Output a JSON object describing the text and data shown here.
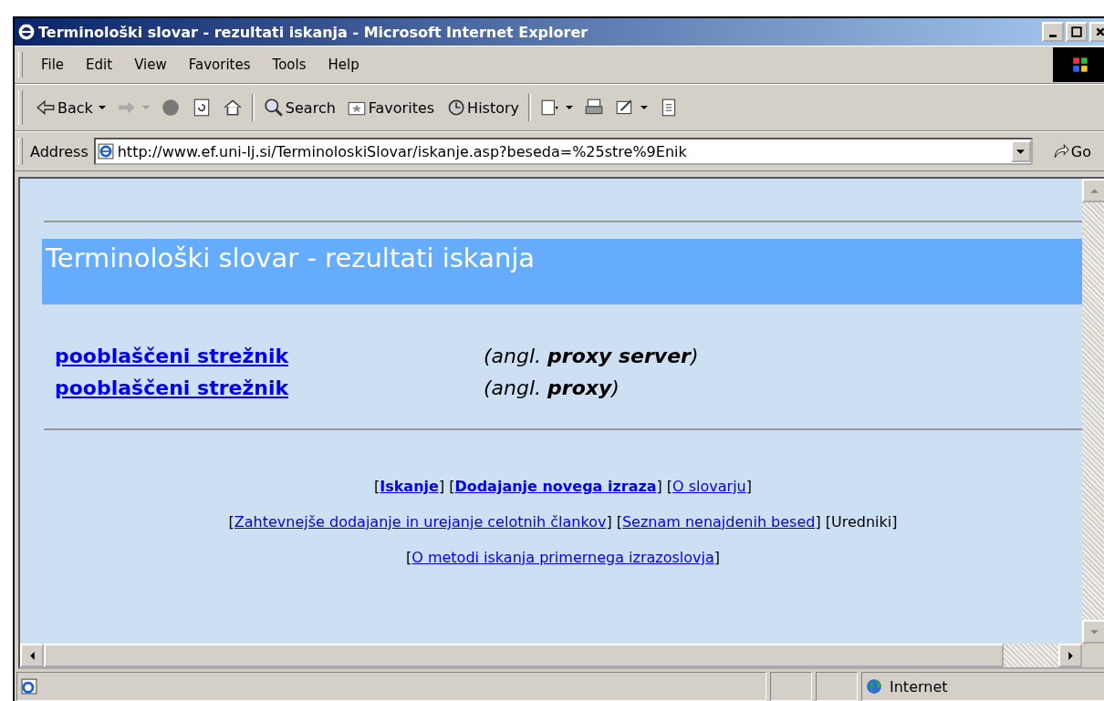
{
  "window": {
    "title": "Terminološki slovar - rezultati iskanja - Microsoft Internet Explorer"
  },
  "menu": [
    "File",
    "Edit",
    "View",
    "Favorites",
    "Tools",
    "Help"
  ],
  "toolbar": [
    {
      "kind": "back",
      "label": "Back"
    },
    {
      "kind": "forward"
    },
    {
      "kind": "stop"
    },
    {
      "kind": "refresh"
    },
    {
      "kind": "home"
    },
    {
      "kind": "search",
      "label": "Search"
    },
    {
      "kind": "favorites",
      "label": "Favorites"
    },
    {
      "kind": "history",
      "label": "History"
    },
    {
      "kind": "mail"
    },
    {
      "kind": "print"
    },
    {
      "kind": "edit"
    },
    {
      "kind": "discuss"
    }
  ],
  "address": {
    "label": "Address",
    "value": "http://www.ef.uni-lj.si/TerminoloskiSlovar/iskanje.asp?beseda=%25stre%9Enik",
    "go": "Go"
  },
  "page": {
    "heading": "Terminološki slovar - rezultati iskanja",
    "results": [
      {
        "term": "pooblaščeni strežnik",
        "translation": "(*angl.* **proxy server**)"
      },
      {
        "term": "pooblaščeni strežnik",
        "translation": "(*angl.* **proxy**)"
      }
    ],
    "footer": [
      [
        {
          "open": "[",
          "text": "Iskanje",
          "close": "]",
          "kind": "bold-link"
        },
        {
          "open": "[",
          "text": "Dodajanje novega izraza",
          "close": "]",
          "kind": "bold-link"
        },
        {
          "open": "[",
          "text": "O slovarju",
          "close": "]",
          "kind": "link"
        }
      ],
      [
        {
          "open": "[",
          "text": "Zahtevnejše dodajanje in urejanje celotnih člankov",
          "close": "]",
          "kind": "link"
        },
        {
          "open": "[",
          "text": "Seznam nenajdenih besed",
          "close": "]",
          "kind": "link"
        },
        {
          "open": "[",
          "text": "Uredniki",
          "close": "]",
          "kind": "plain"
        }
      ],
      [
        {
          "open": "[",
          "text": "O metodi iskanja primernega izrazoslovja",
          "close": "]",
          "kind": "link"
        }
      ]
    ]
  },
  "status_bar": {
    "zone": "Internet"
  }
}
